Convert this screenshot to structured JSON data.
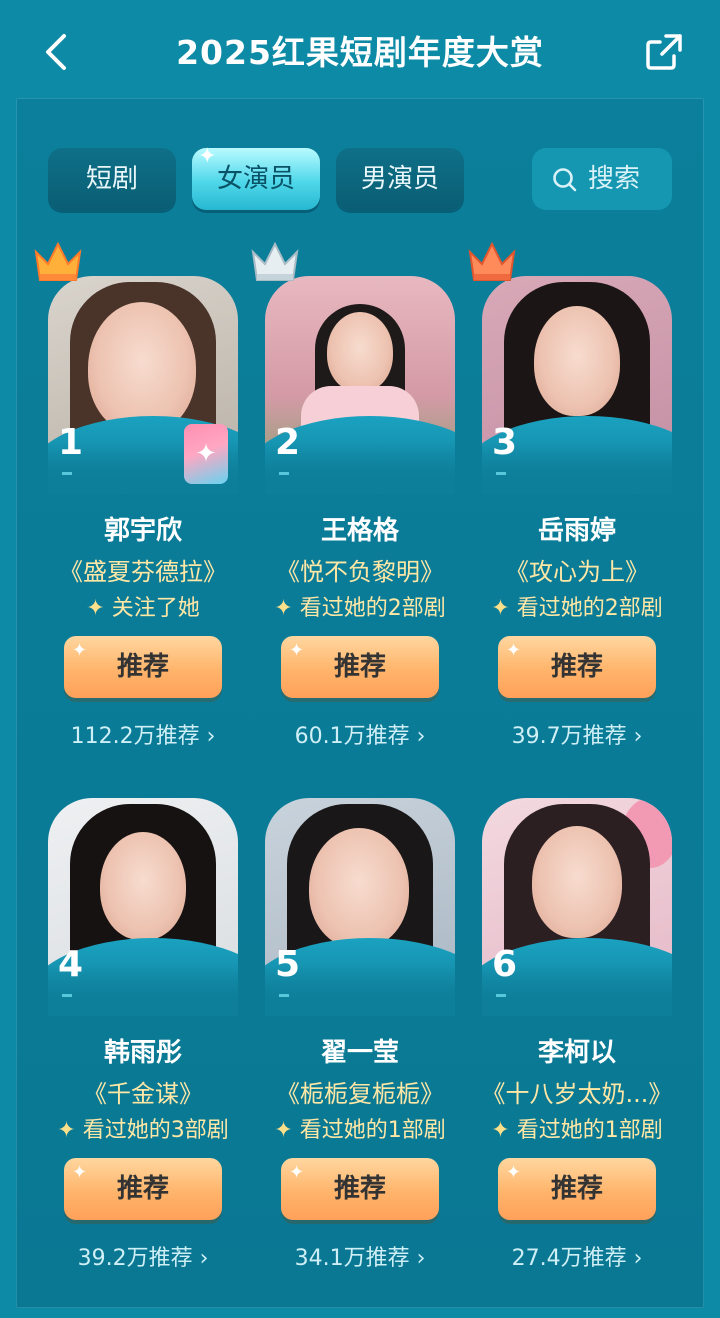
{
  "header": {
    "title": "2025红果短剧年度大赏",
    "back_icon": "chevron-left-icon",
    "share_icon": "share-icon"
  },
  "tabs": [
    {
      "label": "短剧",
      "active": false
    },
    {
      "label": "女演员",
      "active": true
    },
    {
      "label": "男演员",
      "active": false
    }
  ],
  "search": {
    "label": "搜索",
    "icon": "search-icon"
  },
  "colors": {
    "background": "#0d8aa6",
    "accent_gold": "#ffe7a6",
    "button_orange": "#ffb46b",
    "active_tab": "#4fd7ea"
  },
  "button_label": "推荐",
  "actresses": [
    {
      "rank": "1",
      "name": "郭宇欣",
      "drama": "《盛夏芬德拉》",
      "note": "关注了她",
      "count": "112.2万推荐 ›",
      "crown": "gold"
    },
    {
      "rank": "2",
      "name": "王格格",
      "drama": "《悦不负黎明》",
      "note": "看过她的2部剧",
      "count": "60.1万推荐 ›",
      "crown": "silver"
    },
    {
      "rank": "3",
      "name": "岳雨婷",
      "drama": "《攻心为上》",
      "note": "看过她的2部剧",
      "count": "39.7万推荐 ›",
      "crown": "bronze"
    },
    {
      "rank": "4",
      "name": "韩雨彤",
      "drama": "《千金谋》",
      "note": "看过她的3部剧",
      "count": "39.2万推荐 ›"
    },
    {
      "rank": "5",
      "name": "翟一莹",
      "drama": "《栀栀复栀栀》",
      "note": "看过她的1部剧",
      "count": "34.1万推荐 ›"
    },
    {
      "rank": "6",
      "name": "李柯以",
      "drama": "《十八岁太奶...》",
      "note": "看过她的1部剧",
      "count": "27.4万推荐 ›"
    }
  ]
}
